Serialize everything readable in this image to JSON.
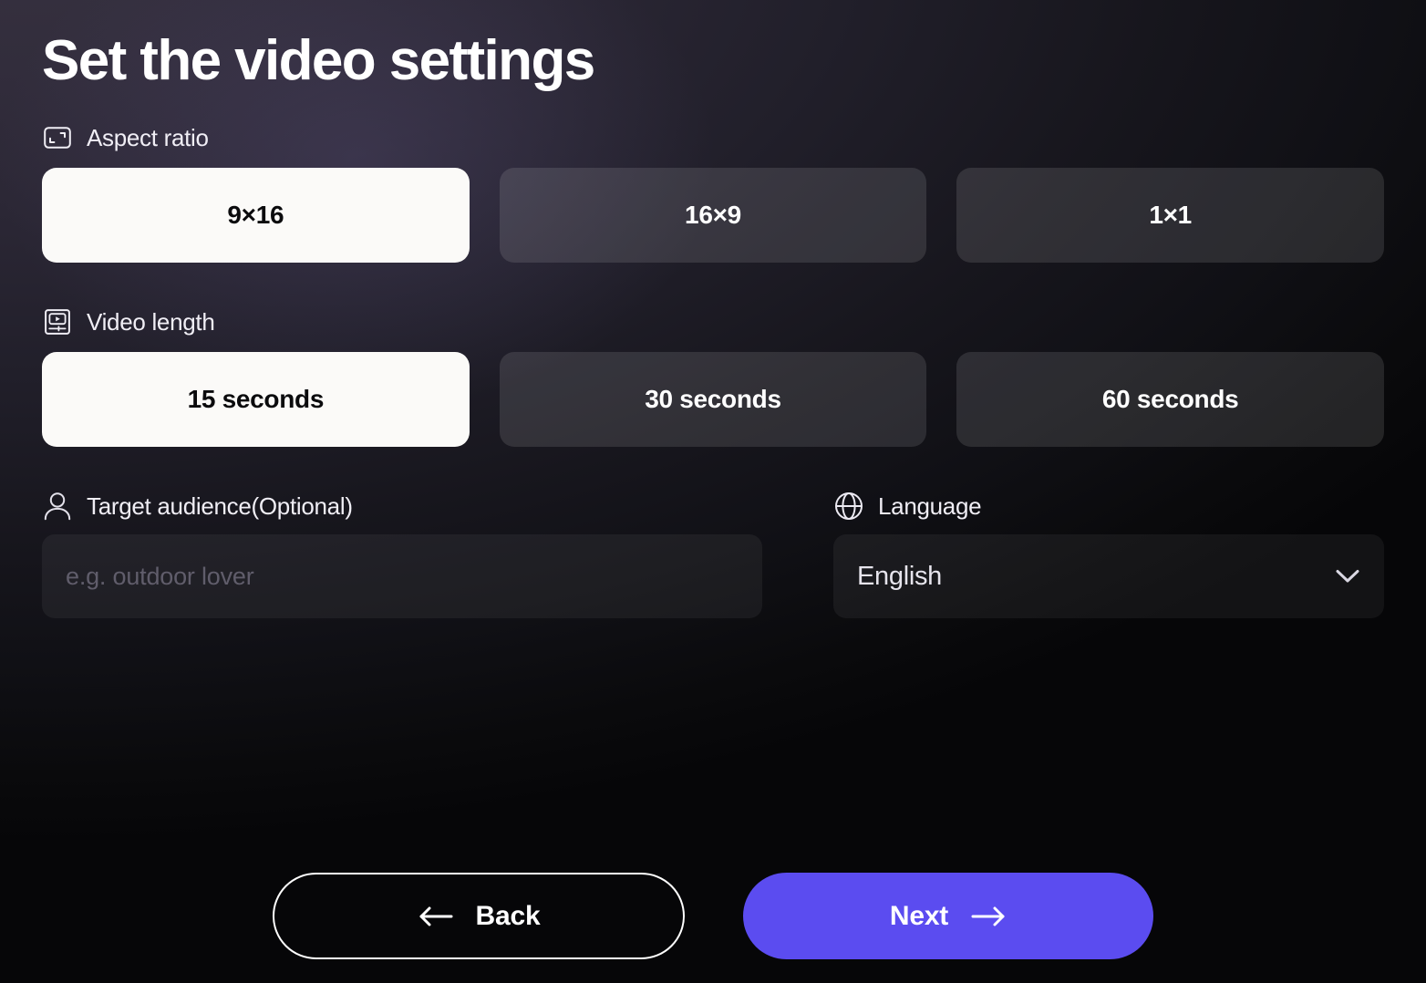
{
  "page": {
    "title": "Set the video settings",
    "accent_color": "#5b4cf0",
    "selected_option_bg": "#fbfaf8",
    "unselected_option_bg": "#4c4859",
    "background_top_color": "#322d3c",
    "background_bottom_color": "#0a0a0c"
  },
  "aspect_ratio": {
    "icon": "aspect-ratio-icon",
    "label": "Aspect ratio",
    "options": [
      {
        "label": "9×16",
        "selected": true
      },
      {
        "label": "16×9",
        "selected": false
      },
      {
        "label": "1×1",
        "selected": false
      }
    ],
    "selected_value": "9×16"
  },
  "video_length": {
    "icon": "video-length-icon",
    "label": "Video length",
    "options": [
      {
        "label": "15 seconds",
        "selected": true
      },
      {
        "label": "30 seconds",
        "selected": false
      },
      {
        "label": "60 seconds",
        "selected": false
      }
    ],
    "selected_value": "15 seconds"
  },
  "target_audience": {
    "icon": "person-icon",
    "label": "Target audience(Optional)",
    "value": "",
    "placeholder": "e.g. outdoor lover"
  },
  "language": {
    "icon": "globe-icon",
    "label": "Language",
    "selected_value": "English",
    "chevron_icon": "chevron-down-icon"
  },
  "footer": {
    "back_label": "Back",
    "back_icon": "arrow-left-icon",
    "next_label": "Next",
    "next_icon": "arrow-right-icon"
  }
}
